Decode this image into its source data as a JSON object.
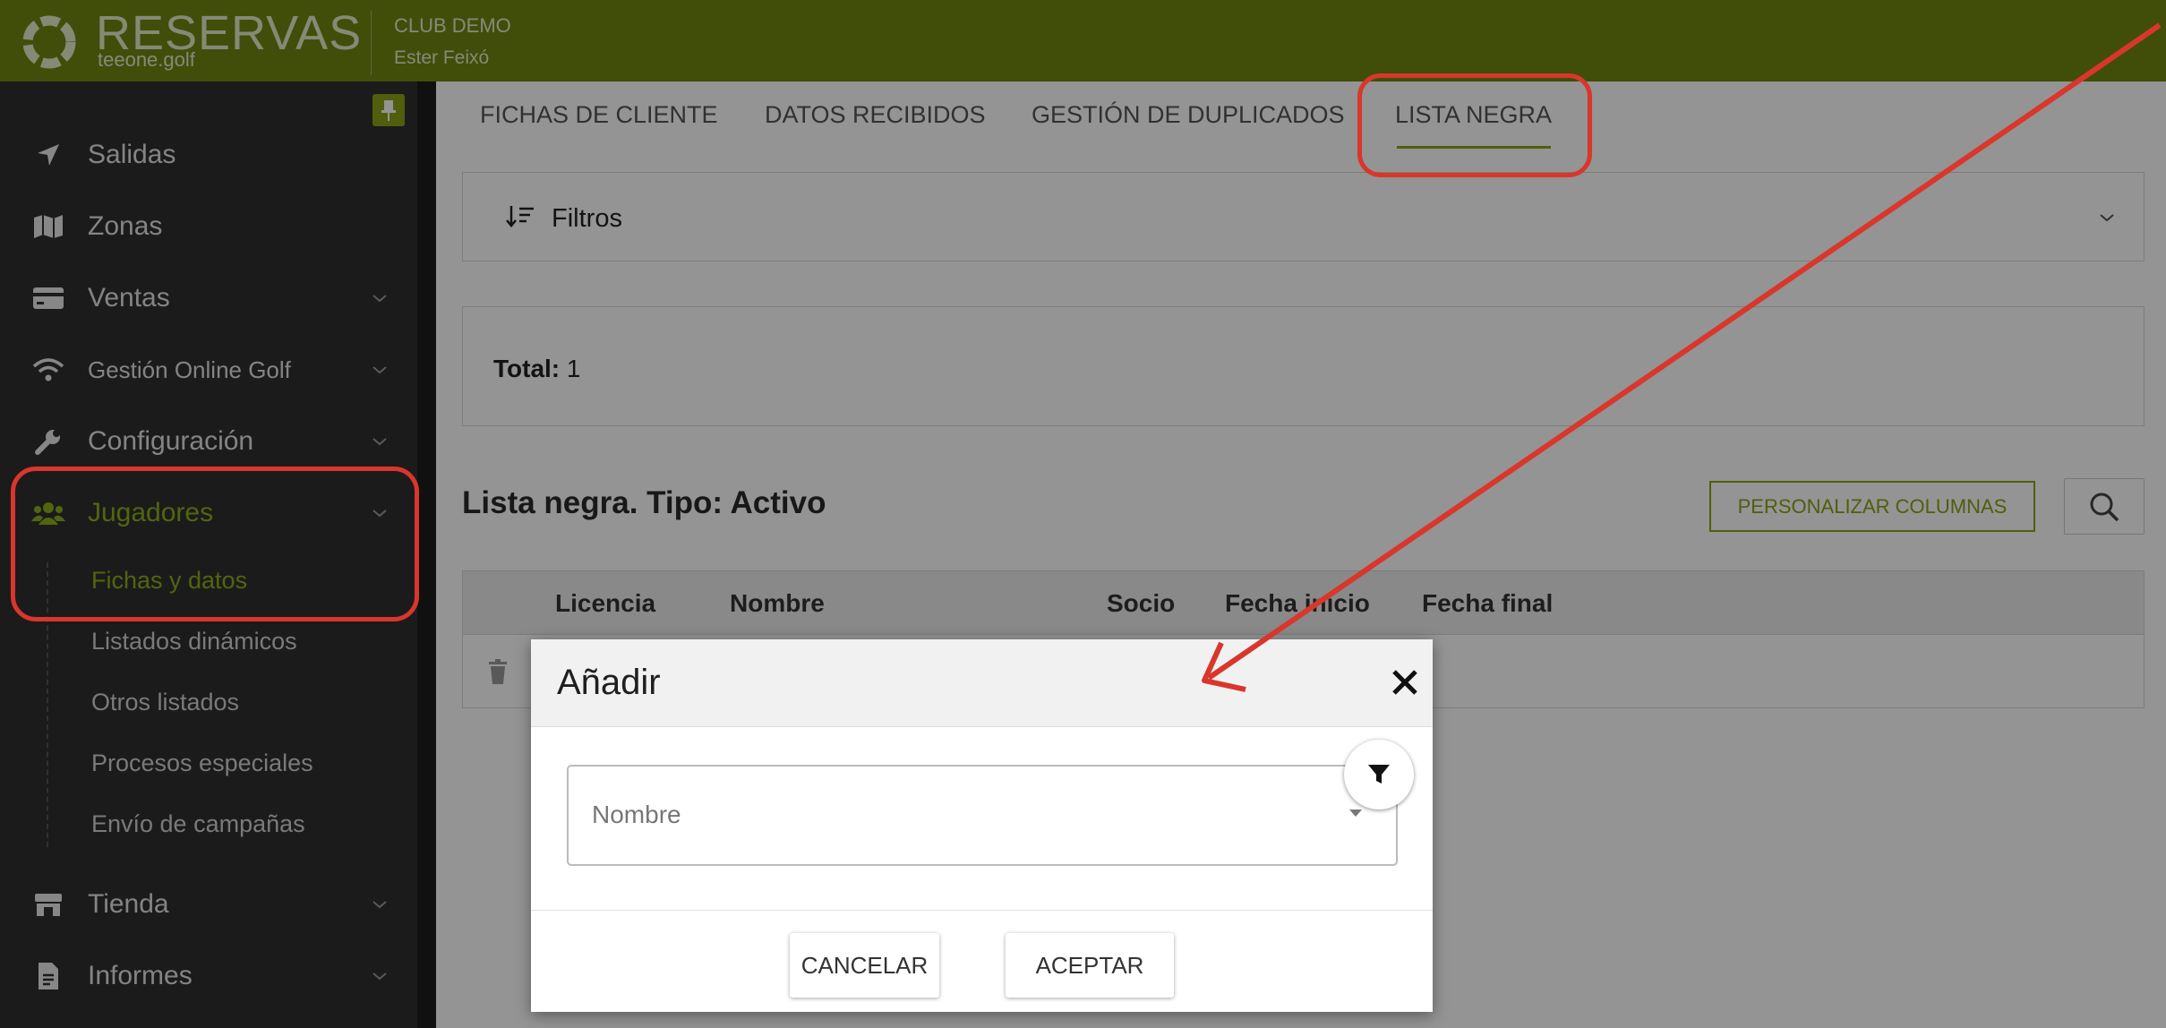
{
  "header": {
    "logo_text": "RESERVAS",
    "logo_sub": "teeone.golf",
    "club": "CLUB DEMO",
    "user": "Ester Feixó"
  },
  "sidebar": {
    "items": [
      {
        "label": "Salidas",
        "icon": "location-arrow-icon"
      },
      {
        "label": "Zonas",
        "icon": "map-icon"
      },
      {
        "label": "Ventas",
        "icon": "credit-card-icon"
      },
      {
        "label": "Gestión Online Golf",
        "icon": "wifi-icon"
      },
      {
        "label": "Configuración",
        "icon": "wrench-icon"
      },
      {
        "label": "Jugadores",
        "icon": "users-icon"
      },
      {
        "label": "Tienda",
        "icon": "store-icon"
      },
      {
        "label": "Informes",
        "icon": "file-report-icon"
      }
    ],
    "subitems": [
      "Fichas y datos",
      "Listados dinámicos",
      "Otros listados",
      "Procesos especiales",
      "Envío de campañas"
    ]
  },
  "tabs": [
    "FICHAS DE CLIENTE",
    "DATOS RECIBIDOS",
    "GESTIÓN DE DUPLICADOS",
    "LISTA NEGRA"
  ],
  "filters": {
    "label": "Filtros"
  },
  "total": {
    "label": "Total:",
    "value": "1"
  },
  "list": {
    "title": "Lista negra. Tipo: Activo",
    "customize_label": "PERSONALIZAR COLUMNAS",
    "columns": [
      "Licencia",
      "Nombre",
      "Socio",
      "Fecha inicio",
      "Fecha final"
    ]
  },
  "modal": {
    "title": "Añadir",
    "select_placeholder": "Nombre",
    "cancel_label": "CANCELAR",
    "accept_label": "ACEPTAR"
  },
  "colors": {
    "brand": "#6f8712",
    "accent": "#8aa318",
    "annotation": "#d9362c"
  }
}
